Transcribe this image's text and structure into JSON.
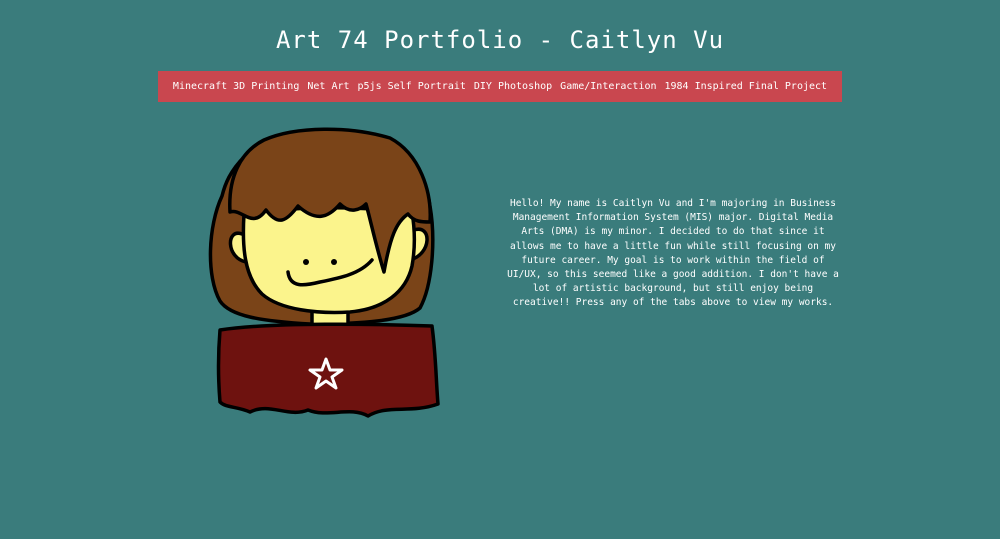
{
  "header": {
    "title": "Art 74 Portfolio - Caitlyn Vu"
  },
  "nav": {
    "items": [
      {
        "label": "Minecraft 3D Printing"
      },
      {
        "label": "Net Art"
      },
      {
        "label": "p5js Self Portrait"
      },
      {
        "label": "DIY Photoshop"
      },
      {
        "label": "Game/Interaction"
      },
      {
        "label": "1984 Inspired Final Project"
      }
    ]
  },
  "main": {
    "intro": "Hello! My name is Caitlyn Vu and I'm majoring in Business Management Information System (MIS) major. Digital Media Arts (DMA) is my minor. I decided to do that since it allows me to have a little fun while still focusing on my future career. My goal is to work within the field of UI/UX, so this seemed like a good addition. I don't have a lot of artistic background, but still enjoy being creative!! Press any of the tabs above to view my works."
  },
  "colors": {
    "background": "#3a7c7c",
    "nav_bar": "#c9474f",
    "hair": "#7a4418",
    "skin": "#fbf48c",
    "shirt": "#6e120f"
  }
}
